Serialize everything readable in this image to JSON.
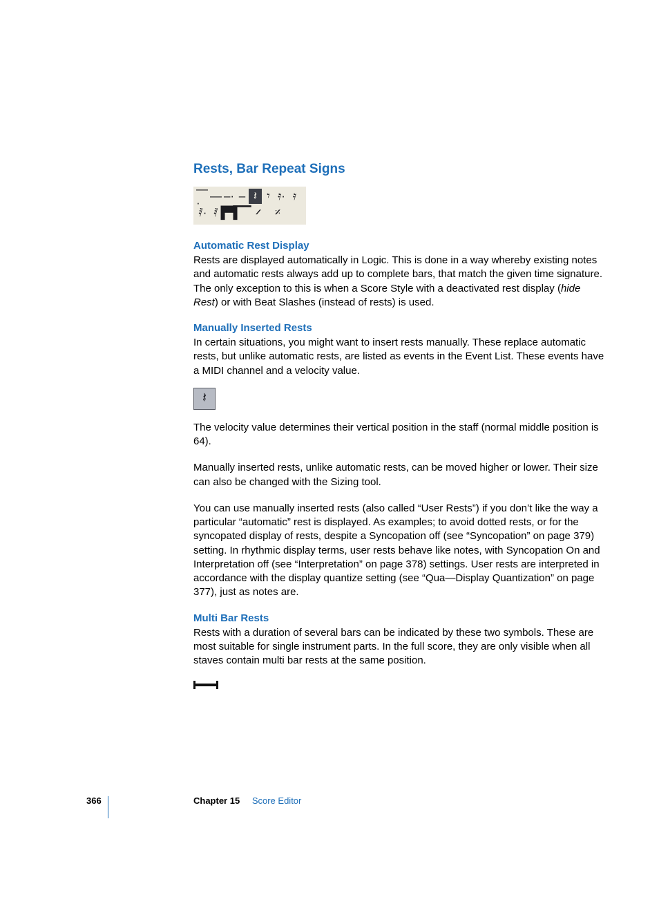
{
  "section": {
    "title": "Rests, Bar Repeat Signs"
  },
  "sub1": {
    "heading": "Automatic Rest Display",
    "p1a": "Rests are displayed automatically in Logic. This is done in a way whereby existing notes and automatic rests always add up to complete bars, that match the given time signature. The only exception to this is when a Score Style with a deactivated rest display (",
    "p1i": "hide Rest",
    "p1b": ") or with Beat Slashes (instead of rests) is used."
  },
  "sub2": {
    "heading": "Manually Inserted Rests",
    "p1": "In certain situations, you might want to insert rests manually. These replace automatic rests, but unlike automatic rests, are listed as events in the Event List. These events have a MIDI channel and a velocity value.",
    "p2": "The velocity value determines their vertical position in the staff (normal middle position is 64).",
    "p3": "Manually inserted rests, unlike automatic rests, can be moved higher or lower. Their size can also be changed with the Sizing tool.",
    "p4": "You can use manually inserted rests (also called “User Rests”) if you don’t like the way a particular “automatic” rest is displayed. As examples; to avoid dotted rests, or for the syncopated display of rests, despite a Syncopation off (see “Syncopation” on page 379) setting. In rhythmic display terms, user rests behave like notes, with Syncopation On and Interpretation off (see “Interpretation” on page 378) settings. User rests are interpreted in accordance with the display quantize setting (see “Qua—Display Quantization” on page 377), just as notes are."
  },
  "sub3": {
    "heading": "Multi Bar Rests",
    "p1": "Rests with a duration of several bars can be indicated by these two symbols. These are most suitable for single instrument parts. In the full score, they are only visible when all staves contain multi bar rests at the same position."
  },
  "glyphs": {
    "r1": [
      "—·",
      "—",
      "–·",
      "–",
      "𝄽",
      "𝄾",
      "𝄿·",
      "𝄿"
    ],
    "r2": [
      "𝅀·",
      "𝅀",
      "▐▀▌",
      "▔▔",
      "𝄍",
      "𝄎"
    ],
    "quarter_rest": "𝄽"
  },
  "footer": {
    "page": "366",
    "chapter": "Chapter 15",
    "name": "Score Editor"
  }
}
